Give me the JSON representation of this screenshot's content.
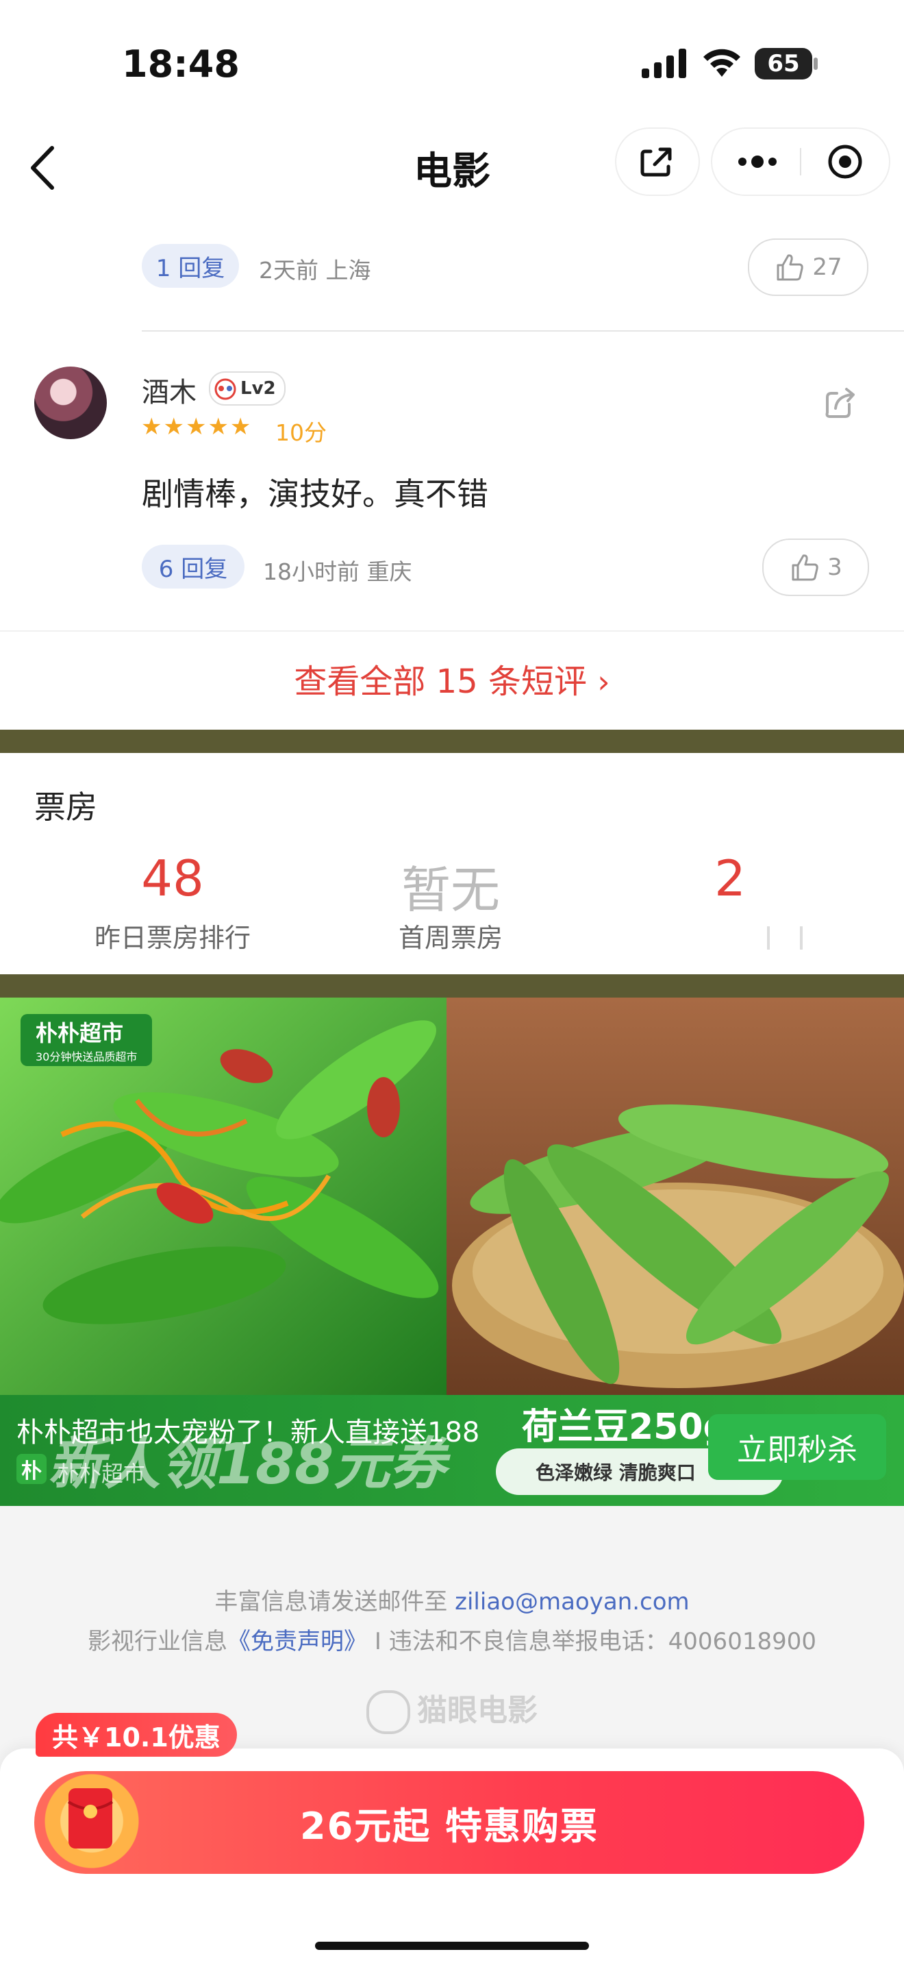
{
  "status": {
    "time": "18:48",
    "battery": "65"
  },
  "nav": {
    "title": "电影"
  },
  "prev_comment": {
    "reply_label": "1 回复",
    "meta": "2天前 上海",
    "likes": "27"
  },
  "comment": {
    "username": "酒木",
    "level": "Lv2",
    "stars": "★★★★★",
    "score": "10分",
    "text": "剧情棒，演技好。真不错",
    "reply_label": "6 回复",
    "meta": "18小时前 重庆",
    "likes": "3"
  },
  "see_all": {
    "label": "查看全部 15 条短评"
  },
  "box_office": {
    "title": "票房",
    "items": [
      {
        "value": "48",
        "label": "昨日票房排行"
      },
      {
        "value": "暂无",
        "label": "首周票房"
      },
      {
        "value": "2",
        "label": ""
      }
    ]
  },
  "ad": {
    "brand_badge": "朴朴超市",
    "brand_sub": "30分钟快送品质超市",
    "product": "荷兰豆250g",
    "tags": "色泽嫩绿  清脆爽口",
    "overlay_big": "新人领188元券",
    "overlay_text": "朴朴超市也太宠粉了！新人直接送188",
    "advertiser": "朴朴超市",
    "cta": "立即秒杀"
  },
  "footer": {
    "line1_prefix": "丰富信息请发送邮件至",
    "email": "ziliao@maoyan.com",
    "line2_prefix": "影视行业信息",
    "disclaimer": "《免责声明》",
    "line2_suffix": "I 违法和不良信息举报电话：4006018900",
    "logo": "猫眼电影"
  },
  "purchase": {
    "coupon": "共￥10.1优惠",
    "button": "26元起 特惠购票"
  },
  "colors": {
    "accent_red": "#e2413a",
    "olive_band": "#5b5a33",
    "ad_green": "#2f9a3a"
  }
}
